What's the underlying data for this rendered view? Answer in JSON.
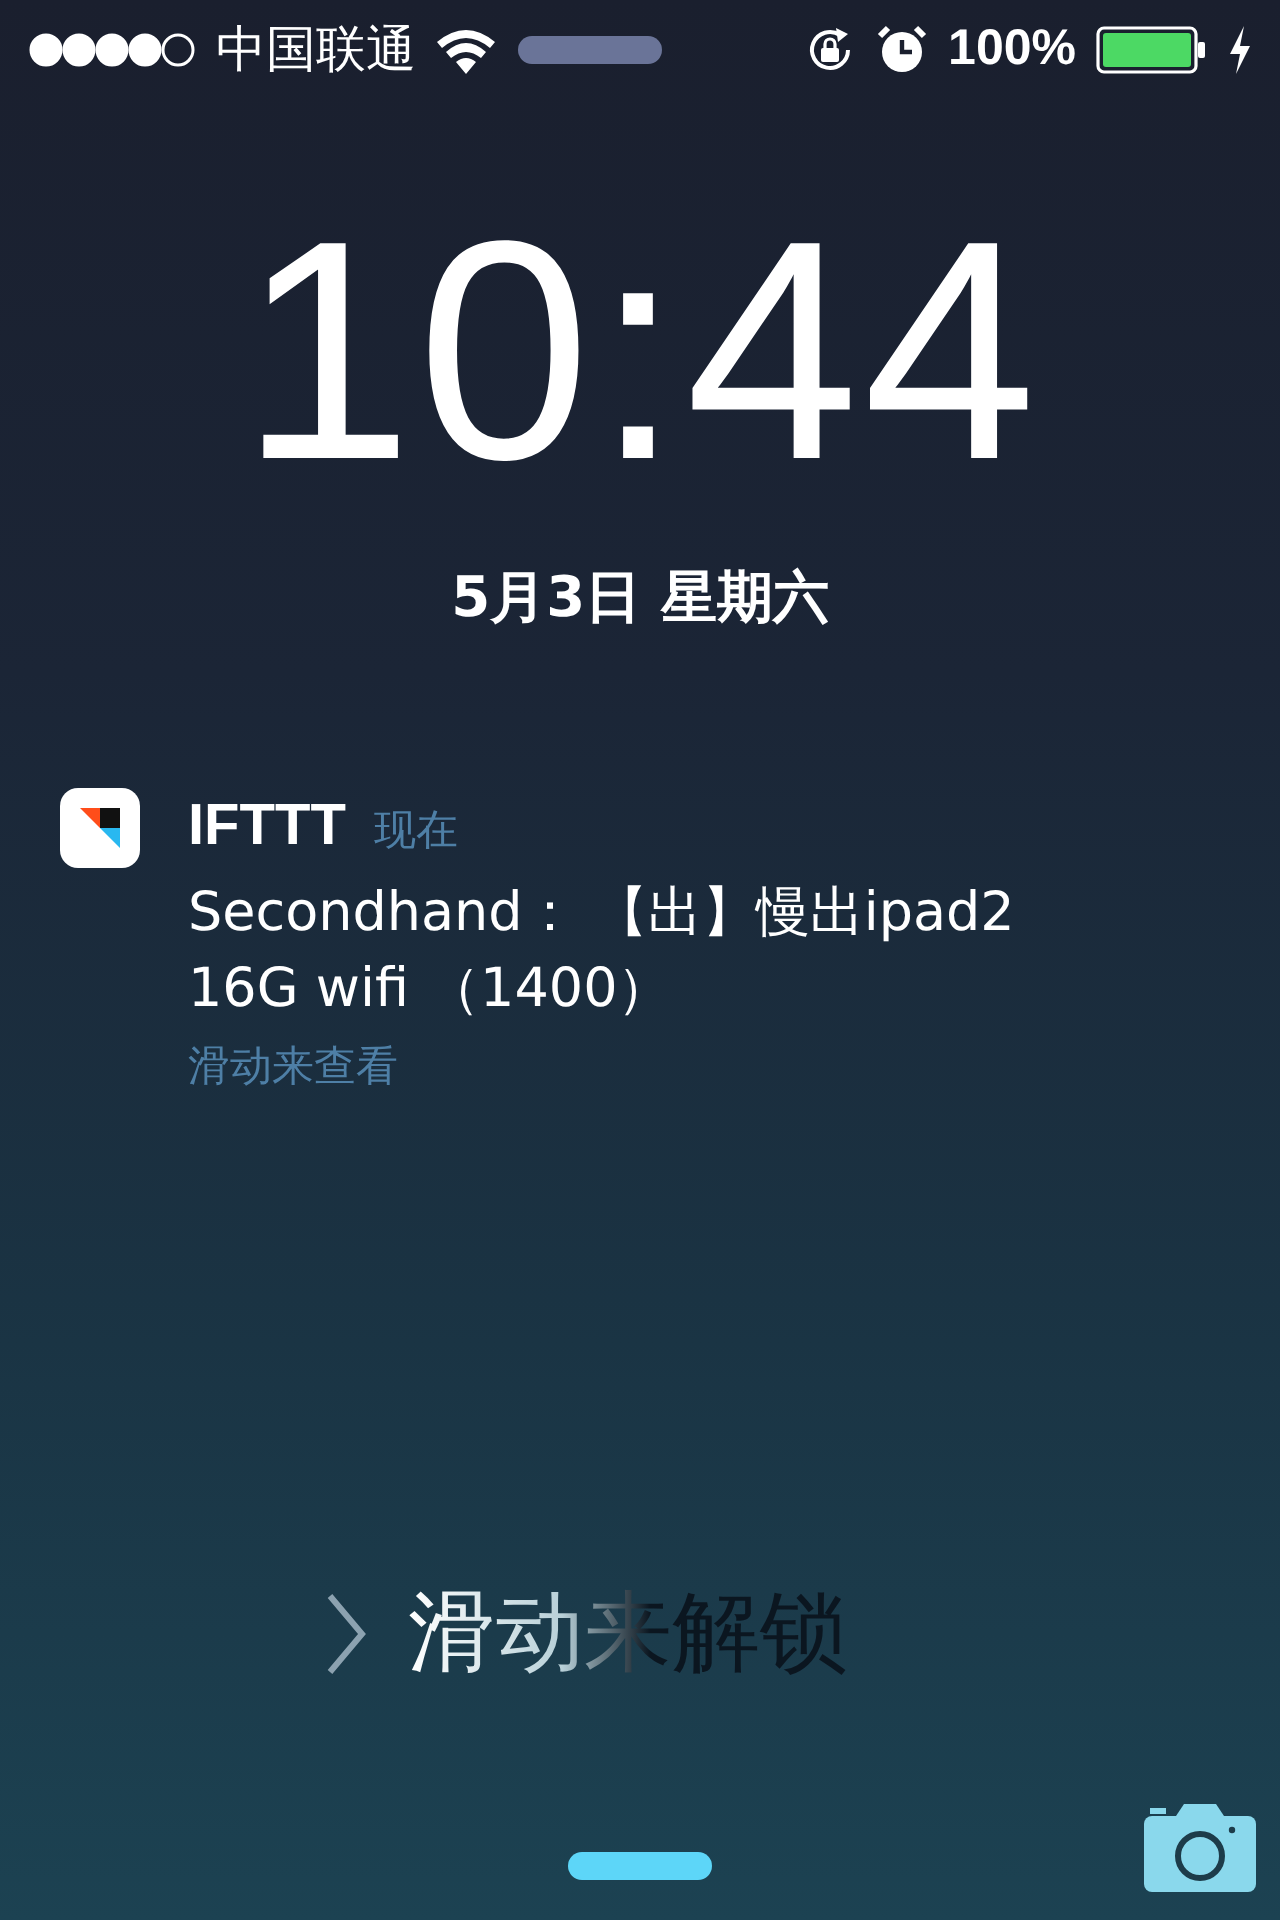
{
  "status_bar": {
    "carrier": "中国联通",
    "battery_percent": "100%",
    "charging": true
  },
  "clock": {
    "time": "10:44",
    "date": "5月3日 星期六"
  },
  "notifications": [
    {
      "app": "IFTTT",
      "time": "现在",
      "message": "Secondhand： 【出】慢出ipad2 16G wifi （1400）",
      "action": "滑动来查看"
    }
  ],
  "unlock": {
    "label": "滑动来解锁"
  }
}
